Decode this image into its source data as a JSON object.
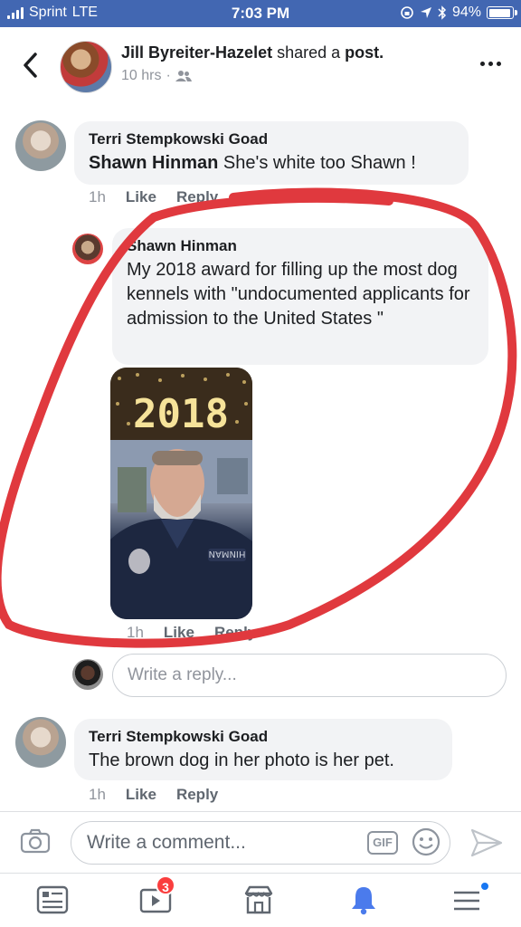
{
  "status": {
    "carrier": "Sprint",
    "network": "LTE",
    "time": "7:03 PM",
    "battery": "94%",
    "battery_level": 0.94
  },
  "header": {
    "author": "Jill Byreiter-Hazelet",
    "action": "shared a",
    "object": "post.",
    "time": "10 hrs",
    "audience_icon": "friends-icon"
  },
  "comments": [
    {
      "name": "Terri Stempkowski Goad",
      "mention": "Shawn Hinman",
      "text": "She's white too Shawn !",
      "time": "1h",
      "like": "Like",
      "reply": "Reply"
    },
    {
      "name": "Shawn Hinman",
      "text": "My 2018 award for filling up the most dog kennels with \"undocumented applicants for admission to the United States \"",
      "time": "1h",
      "like": "Like",
      "reply": "Reply",
      "photo_text": "2018",
      "photo_patch": "HINMAN"
    },
    {
      "name": "Terri Stempkowski Goad",
      "text": "The brown dog in her photo is her pet.",
      "time": "1h",
      "like": "Like",
      "reply": "Reply"
    }
  ],
  "reply_placeholder": "Write a reply...",
  "comment_placeholder": "Write a comment...",
  "gif_label": "GIF",
  "tabs": {
    "notifications_badge": "3"
  },
  "colors": {
    "brand": "#4267b2",
    "annotation": "#e0393e",
    "badge": "#fa3e3e"
  }
}
